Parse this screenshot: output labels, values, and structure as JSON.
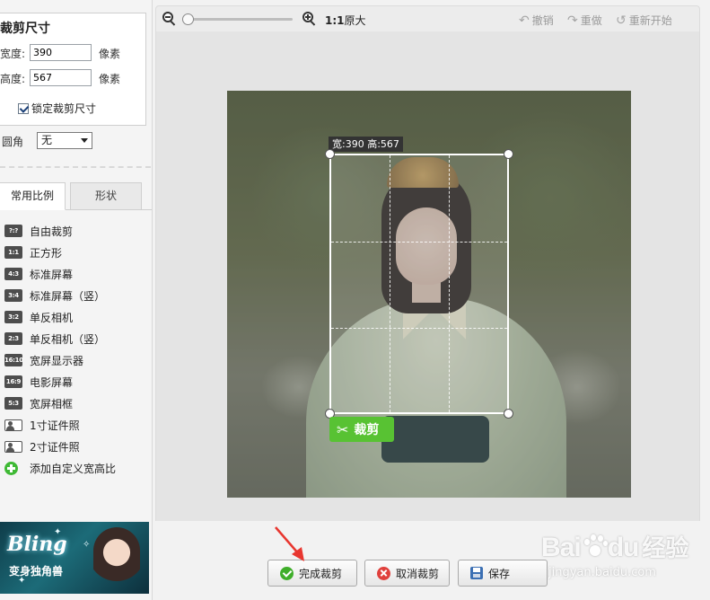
{
  "left_panel": {
    "title": "裁剪尺寸",
    "width_label": "宽度:",
    "width_value": "390",
    "height_label": "高度:",
    "height_value": "567",
    "unit": "像素",
    "lock_label": "锁定裁剪尺寸",
    "lock_checked": true,
    "corner_label": "圆角",
    "corner_value": "无",
    "tabs": [
      "常用比例",
      "形状"
    ],
    "ratios": [
      {
        "badge": "?:?",
        "label": "自由裁剪"
      },
      {
        "badge": "1:1",
        "label": "正方形"
      },
      {
        "badge": "4:3",
        "label": "标准屏幕"
      },
      {
        "badge": "3:4",
        "label": "标准屏幕（竖）"
      },
      {
        "badge": "3:2",
        "label": "单反相机"
      },
      {
        "badge": "2:3",
        "label": "单反相机（竖）"
      },
      {
        "badge": "16:10",
        "label": "宽屏显示器"
      },
      {
        "badge": "16:9",
        "label": "电影屏幕"
      },
      {
        "badge": "5:3",
        "label": "宽屏相框"
      },
      {
        "badge": "id-card-icon",
        "label": "1寸证件照"
      },
      {
        "badge": "id-card-icon",
        "label": "2寸证件照"
      },
      {
        "badge": "plus-icon",
        "label": "添加自定义宽高比"
      }
    ],
    "banner": {
      "brand": "Bling",
      "subtitle": "变身独角兽"
    }
  },
  "toolbar": {
    "actual_size_bold": "1:1",
    "actual_size_text": "原大",
    "undo": "撤销",
    "redo": "重做",
    "restart": "重新开始",
    "zoom_level": 0
  },
  "crop": {
    "size_tip": "宽:390 高:567",
    "apply_label": "裁剪"
  },
  "bottom": {
    "finish": "完成裁剪",
    "cancel": "取消裁剪",
    "save": "保存"
  },
  "watermark": {
    "brand_a": "Bai",
    "brand_b": "du",
    "brand_cn": "经验",
    "url": "jingyan.baidu.com"
  },
  "colors": {
    "accent_green": "#58c233",
    "arrow_red": "#e8362f"
  }
}
